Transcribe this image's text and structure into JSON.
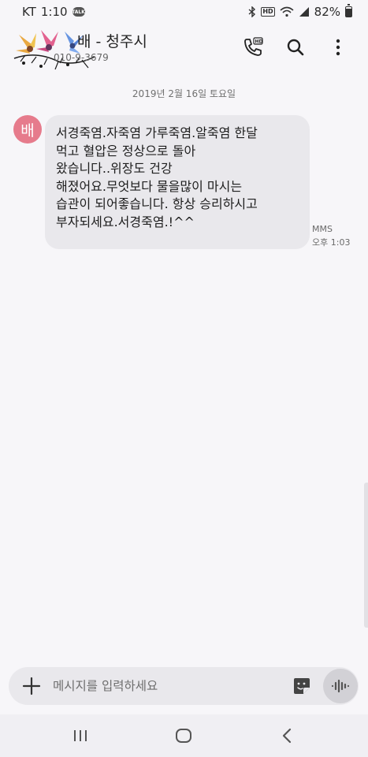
{
  "status_bar": {
    "carrier": "KT",
    "time": "1:10",
    "battery": "82%"
  },
  "header": {
    "contact_name": "배 - 청주시",
    "contact_number": "010-9-3679"
  },
  "conversation": {
    "date": "2019년 2월 16일 토요일",
    "messages": [
      {
        "sender_initial": "배",
        "text": "서경죽염.자죽염 가루죽염.알죽염 한달\n먹고 혈압은 정상으로 돌아\n왔습니다..위장도 건강\n해졌어요.무엇보다 물을많이 마시는\n습관이 되어좋습니다. 항상 승리하시고\n부자되세요.서경죽염.!^^",
        "type": "MMS",
        "time": "오후 1:03"
      }
    ]
  },
  "composer": {
    "placeholder": "메시지를 입력하세요"
  },
  "colors": {
    "avatar": "#e67b8c",
    "bubble": "#e9e8ec",
    "background": "#f7f6f9"
  },
  "icons": [
    "talk-icon",
    "bluetooth-icon",
    "wifi-icon",
    "signal-icon",
    "battery-icon",
    "hd-call-icon",
    "search-icon",
    "more-icon",
    "add-icon",
    "sticker-icon",
    "voice-icon",
    "recent-apps-icon",
    "home-icon",
    "back-icon"
  ]
}
